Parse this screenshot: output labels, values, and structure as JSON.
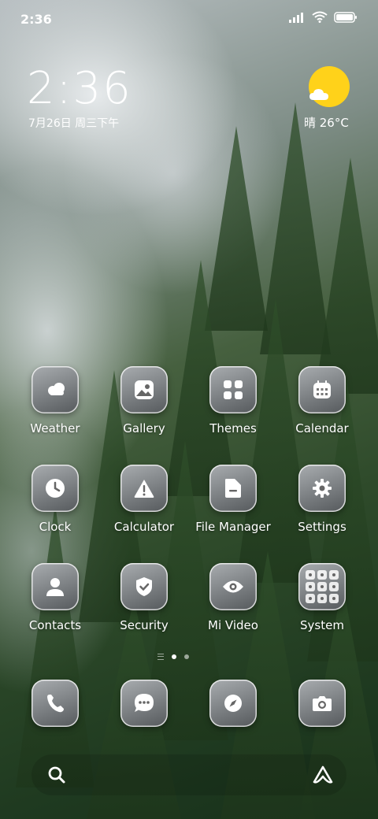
{
  "status_bar": {
    "time": "2:36"
  },
  "lock_clock": {
    "time": "2:36",
    "date": "7月26日 周三下午"
  },
  "weather_widget": {
    "text": "晴 26°C",
    "sun_color": "#ffd21a"
  },
  "apps": [
    {
      "label": "Weather",
      "icon": "weather-cloud-icon"
    },
    {
      "label": "Gallery",
      "icon": "gallery-image-icon"
    },
    {
      "label": "Themes",
      "icon": "themes-grid-icon"
    },
    {
      "label": "Calendar",
      "icon": "calendar-icon"
    },
    {
      "label": "Clock",
      "icon": "clock-icon"
    },
    {
      "label": "Calculator",
      "icon": "warning-triangle-icon"
    },
    {
      "label": "File Manager",
      "icon": "folder-icon"
    },
    {
      "label": "Settings",
      "icon": "gear-icon"
    },
    {
      "label": "Contacts",
      "icon": "person-icon"
    },
    {
      "label": "Security",
      "icon": "shield-check-icon"
    },
    {
      "label": "Mi Video",
      "icon": "eye-icon"
    },
    {
      "label": "System",
      "icon": "folder-grid-icon"
    }
  ],
  "dock": [
    {
      "icon": "phone-icon"
    },
    {
      "icon": "message-icon"
    },
    {
      "icon": "compass-icon"
    },
    {
      "icon": "camera-icon"
    }
  ],
  "page_indicator": {
    "current_page": 1,
    "total_pages": 2
  },
  "search_bar": {
    "left_icon": "search-icon",
    "right_icon": "assistant-icon"
  }
}
